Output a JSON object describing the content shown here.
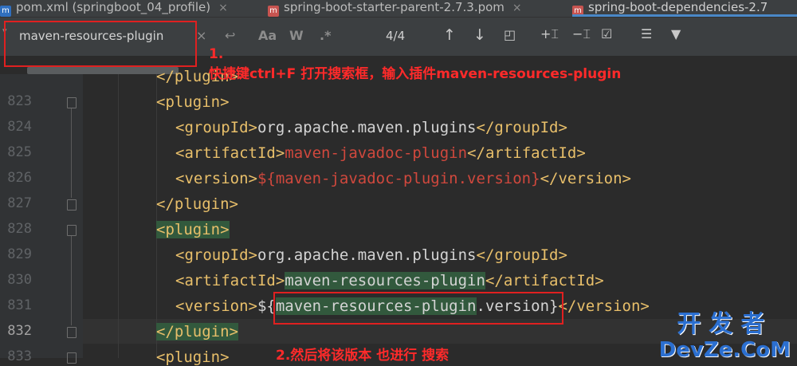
{
  "tabs": [
    {
      "label": "pom.xml (springboot_04_profile)",
      "icon": "maven-m-icon",
      "active": false
    },
    {
      "label": "spring-boot-starter-parent-2.7.3.pom",
      "icon": "maven-pom-icon",
      "active": false
    },
    {
      "label": "spring-boot-dependencies-2.7",
      "icon": "maven-pom-icon",
      "active": true
    }
  ],
  "search": {
    "query": "maven-resources-plugin",
    "match_count": "4/4",
    "option_match_case": "Aa",
    "option_words": "W",
    "option_regex": ".*"
  },
  "lines": [
    {
      "num": "823"
    },
    {
      "num": "824"
    },
    {
      "num": "825"
    },
    {
      "num": "826"
    },
    {
      "num": "827"
    },
    {
      "num": "828"
    },
    {
      "num": "829"
    },
    {
      "num": "830"
    },
    {
      "num": "831"
    },
    {
      "num": "832"
    },
    {
      "num": "833"
    }
  ],
  "code": {
    "l822": "</plugin>",
    "l823": "<plugin>",
    "l824_open": "<groupId>",
    "l824_text": "org.apache.maven.plugins",
    "l824_close": "</groupId>",
    "l825_open": "<artifactId>",
    "l825_text": "maven-javadoc-plugin",
    "l825_close": "</artifactId>",
    "l826_open": "<version>",
    "l826_text": "${maven-javadoc-plugin.version}",
    "l826_close": "</version>",
    "l827": "</plugin>",
    "l828": "<plugin>",
    "l829_open": "<groupId>",
    "l829_text": "org.apache.maven.plugins",
    "l829_close": "</groupId>",
    "l830_open": "<artifactId>",
    "l830_text": "maven-resources-plugin",
    "l830_close": "</artifactId>",
    "l831_open": "<version>",
    "l831_pre": "${",
    "l831_match": "maven-resources-plugin",
    "l831_post": ".version}",
    "l831_close": "</version>",
    "l832": "</plugin>",
    "l833": "<plugin>"
  },
  "annotations": {
    "a1_num": "1.",
    "a1_text": "快捷键ctrl+F 打开搜索框，输入插件maven-resources-plugin",
    "a2_text": "2.然后将该版本 也进行 搜索"
  },
  "watermark": {
    "zh": "开发者",
    "en": "DevZe.CoM"
  }
}
